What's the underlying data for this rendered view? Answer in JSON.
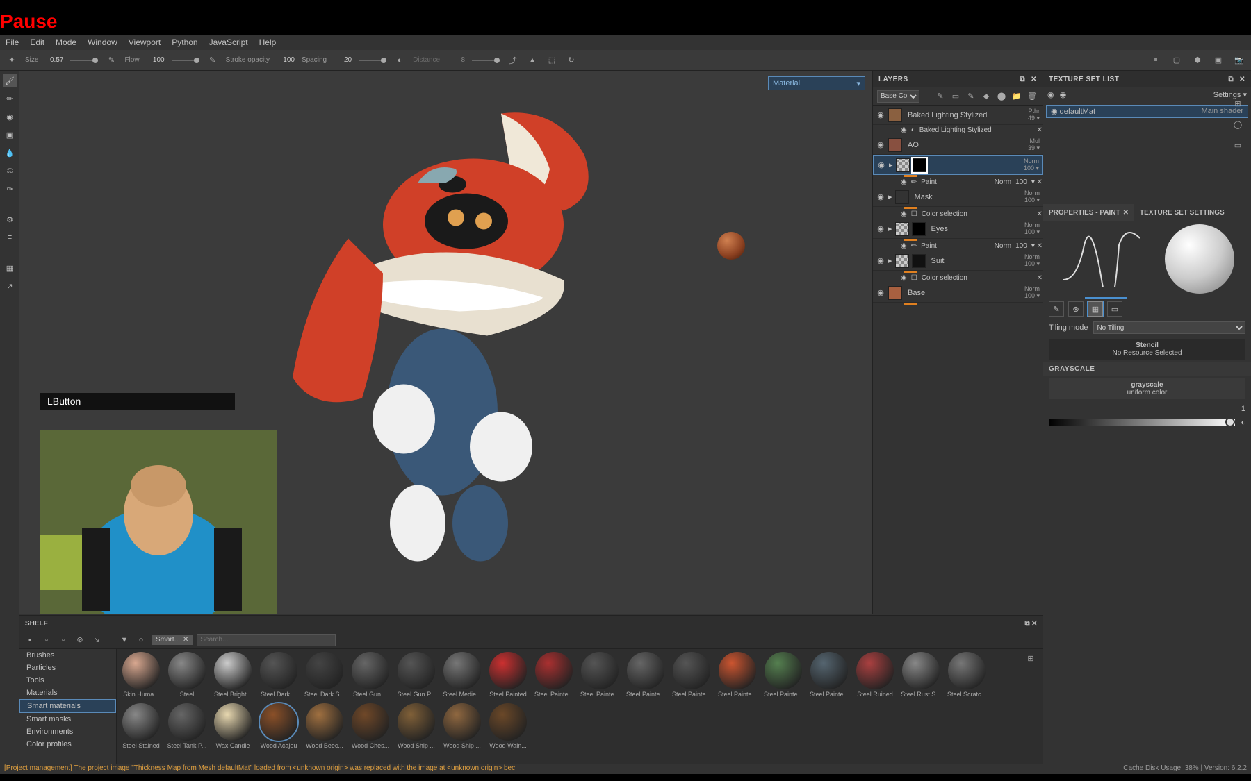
{
  "overlay": {
    "pause": "Pause",
    "keypress": "LButton"
  },
  "menu": [
    "File",
    "Edit",
    "Mode",
    "Window",
    "Viewport",
    "Python",
    "JavaScript",
    "Help"
  ],
  "toolbar": {
    "size_label": "Size",
    "size_val": "0.57",
    "flow_label": "Flow",
    "flow_val": "100",
    "opacity_label": "Stroke opacity",
    "opacity_val": "100",
    "spacing_label": "Spacing",
    "spacing_val": "20",
    "distance_label": "Distance",
    "distance_val": "8"
  },
  "viewport": {
    "channel": "Material"
  },
  "layers": {
    "title": "LAYERS",
    "blend_dropdown": "Base Co",
    "items": [
      {
        "name": "Baked Lighting Stylized",
        "blend": "Pthr",
        "opacity": "49"
      },
      {
        "name": "Baked Lighting Stylized",
        "sub": true
      },
      {
        "name": "AO",
        "blend": "Mul",
        "opacity": "39"
      },
      {
        "name": "",
        "blend": "Norm",
        "opacity": "100",
        "selected": true,
        "paint_label": "Paint",
        "paint_blend": "Norm",
        "paint_opacity": "100"
      },
      {
        "name": "Mask",
        "blend": "Norm",
        "opacity": "100",
        "effect": "Color selection"
      },
      {
        "name": "Eyes",
        "blend": "Norm",
        "opacity": "100",
        "paint_label": "Paint",
        "paint_blend": "Norm",
        "paint_opacity": "100"
      },
      {
        "name": "Suit",
        "blend": "Norm",
        "opacity": "100",
        "effect": "Color selection"
      },
      {
        "name": "Base",
        "blend": "Norm",
        "opacity": "100"
      }
    ]
  },
  "texset": {
    "title": "TEXTURE SET LIST",
    "settings": "Settings",
    "item": "defaultMat",
    "shader": "Main shader"
  },
  "props": {
    "tab1": "PROPERTIES - PAINT",
    "tab2": "TEXTURE SET SETTINGS",
    "tiling_label": "Tiling mode",
    "tiling_val": "No Tiling",
    "stencil_title": "Stencil",
    "stencil_val": "No Resource Selected",
    "grayscale_title": "GRAYSCALE",
    "gray_name": "grayscale",
    "gray_sub": "uniform color",
    "gray_val": "1"
  },
  "shelf": {
    "title": "SHELF",
    "filter_tag": "Smart...",
    "search_placeholder": "Search...",
    "categories": [
      "Brushes",
      "Particles",
      "Tools",
      "Materials",
      "Smart materials",
      "Smart masks",
      "Environments",
      "Color profiles"
    ],
    "active_cat": "Smart materials",
    "row1": [
      "Skin Huma...",
      "Steel",
      "Steel Bright...",
      "Steel Dark ...",
      "Steel Dark S...",
      "Steel Gun ...",
      "Steel Gun P...",
      "Steel Medie...",
      "Steel Painted",
      "Steel Painte...",
      "Steel Painte...",
      "Steel Painte...",
      "Steel Painte...",
      "Steel Painte...",
      "Steel Painte...",
      "Steel Painte...",
      "Steel Ruined",
      "Steel Rust S...",
      "Steel Scratc..."
    ],
    "row2": [
      "Steel Stained",
      "Steel Tank P...",
      "Wax Candle",
      "Wood Acajou",
      "Wood Beec...",
      "Wood Ches...",
      "Wood Ship ...",
      "Wood Ship ...",
      "Wood Waln..."
    ],
    "selected": "Wood Acajou",
    "colors1": [
      "#d9a890",
      "#888",
      "#ccc",
      "#555",
      "#444",
      "#666",
      "#555",
      "#777",
      "#cc3030",
      "#aa3030",
      "#555",
      "#666",
      "#555",
      "#cc5530",
      "#558050",
      "#556570",
      "#aa4040",
      "#888",
      "#777",
      "#888"
    ],
    "colors2": [
      "#888",
      "#666",
      "#e8d8b0",
      "#8b5028",
      "#a07040",
      "#704828",
      "#806038",
      "#906840",
      "#6b4828"
    ]
  },
  "status": {
    "left": "[Project management] The project image \"Thickness Map from Mesh defaultMat\" loaded from <unknown origin> was replaced with the image at <unknown origin> bec",
    "right": "Cache Disk Usage:   38% | Version: 6.2.2"
  }
}
